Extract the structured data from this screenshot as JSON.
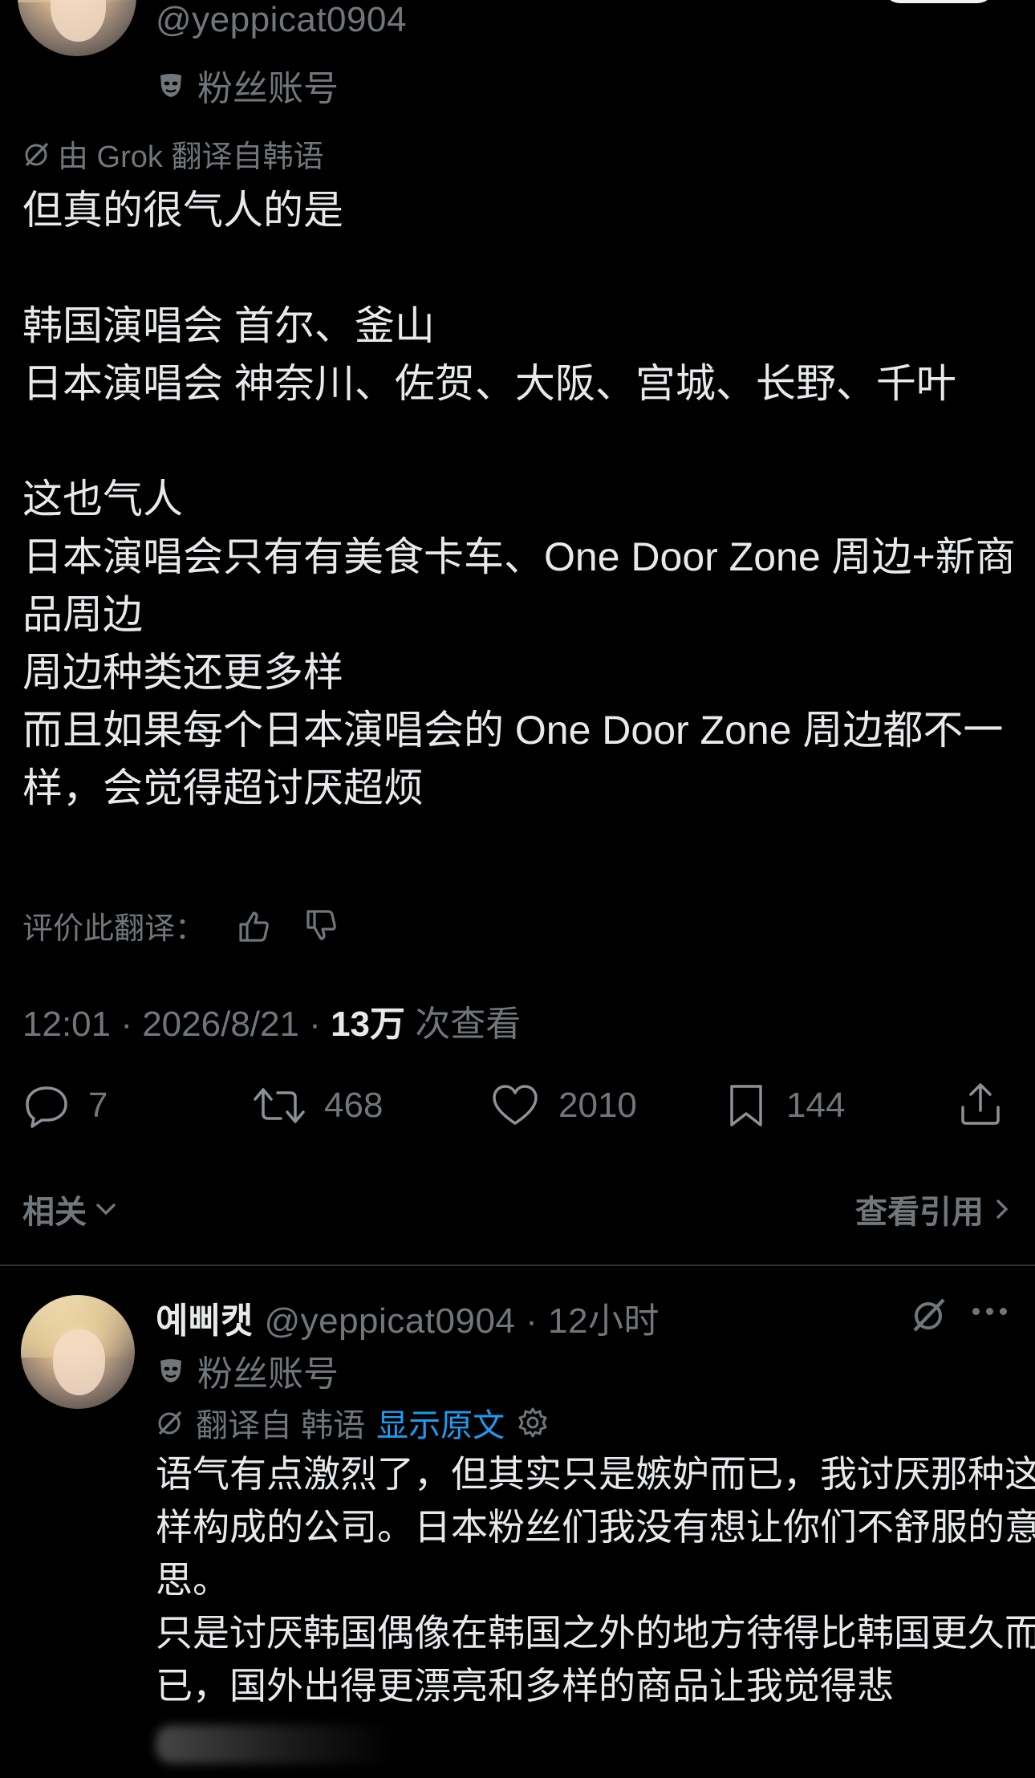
{
  "top_tweet": {
    "handle": "@yeppicat0904",
    "fan_label": "粉丝账号",
    "translation_note": "由 Grok 翻译自韩语",
    "text": "但真的很气人的是\n\n韩国演唱会 首尔、釜山\n日本演唱会 神奈川、佐贺、大阪、宫城、长野、千叶\n\n这也气人\n日本演唱会只有有美食卡车、One Door Zone 周边+新商品周边\n周边种类还更多样\n而且如果每个日本演唱会的 One Door Zone 周边都不一样，会觉得超讨厌超烦",
    "rate_label": "评价此翻译：",
    "time": "12:01 · 2026/8/21 · ",
    "views_count": "13万",
    "views_label": " 次查看",
    "actions": {
      "replies": "7",
      "reposts": "468",
      "likes": "2010",
      "bookmarks": "144"
    },
    "related_label": "相关",
    "quotes_label": "查看引用"
  },
  "reply": {
    "display_name": "예삐캣",
    "handle_time": "@yeppicat0904 · 12小时",
    "fan_label": "粉丝账号",
    "translated_from": "翻译自 韩语",
    "show_original": "显示原文",
    "text": "语气有点激烈了，但其实只是嫉妒而已，我讨厌那种这样构成的公司。日本粉丝们我没有想让你们不舒服的意思。\n只是讨厌韩国偶像在韩国之外的地方待得比韩国更久而已，国外出得更漂亮和多样的商品让我觉得悲"
  },
  "icons": {
    "fan_badge": "mask-icon",
    "translate": "grok-icon",
    "thumb_up": "thumb-up-icon",
    "thumb_down": "thumb-down-icon",
    "reply": "reply-icon",
    "repost": "repost-icon",
    "like": "heart-icon",
    "bookmark": "bookmark-icon",
    "share": "share-icon",
    "more": "more-icon",
    "settings": "gear-icon"
  },
  "colors": {
    "background": "#000000",
    "text": "#e7e9ea",
    "secondary": "#71767b",
    "accent": "#1d9bf0",
    "divider": "#2f3336"
  }
}
